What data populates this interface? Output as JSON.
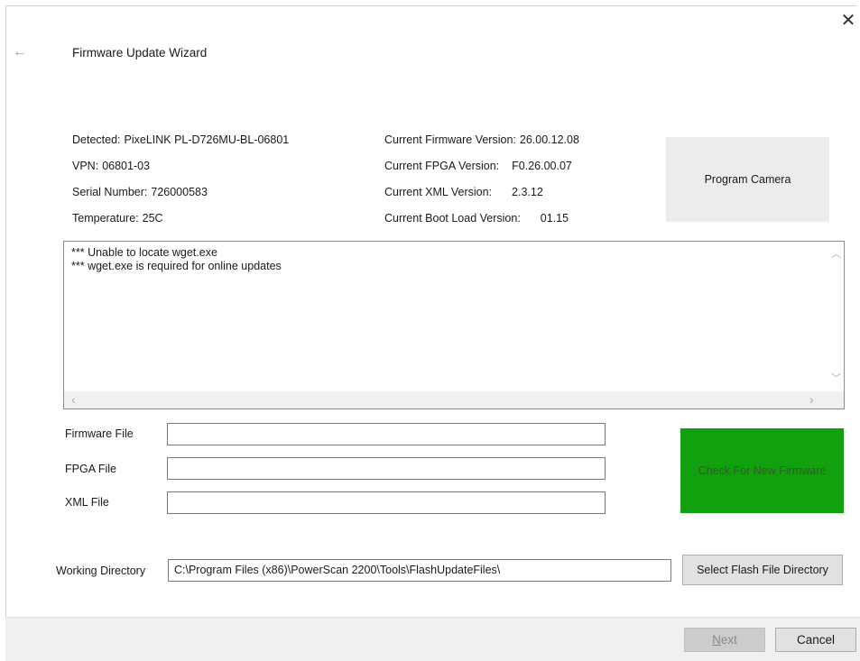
{
  "window": {
    "title": "Firmware Update Wizard",
    "close_glyph": "✕",
    "back_glyph": "←"
  },
  "device": {
    "detected_label": "Detected:",
    "detected_value": "PixeLINK PL-D726MU-BL-06801",
    "vpn_label": "VPN:",
    "vpn_value": "06801-03",
    "serial_label": "Serial Number:",
    "serial_value": "726000583",
    "temp_label": "Temperature:",
    "temp_value": "25C"
  },
  "versions": {
    "firmware_label": "Current Firmware Version:",
    "firmware_value": "26.00.12.08",
    "fpga_label": "Current FPGA Version:",
    "fpga_value": "F0.26.00.07",
    "xml_label": "Current XML Version:",
    "xml_value": "2.3.12",
    "boot_label": "Current Boot Load Version:",
    "boot_value": "01.15"
  },
  "buttons": {
    "program_camera": "Program Camera",
    "check_firmware": "Check For New Firmware",
    "select_directory": "Select Flash File Directory",
    "next": "Next",
    "cancel": "Cancel"
  },
  "log": {
    "text": "*** Unable to locate wget.exe\n*** wget.exe is required for online updates"
  },
  "files": {
    "firmware_label": "Firmware File",
    "firmware_value": "",
    "fpga_label": "FPGA File",
    "fpga_value": "",
    "xml_label": "XML File",
    "xml_value": ""
  },
  "working_directory": {
    "label": "Working Directory",
    "value": "C:\\Program Files (x86)\\PowerScan 2200\\Tools\\FlashUpdateFiles\\"
  },
  "colors": {
    "check_button_bg": "#12a10e",
    "gray_button_bg": "#ececec",
    "footer_bg": "#f0f0f0"
  }
}
